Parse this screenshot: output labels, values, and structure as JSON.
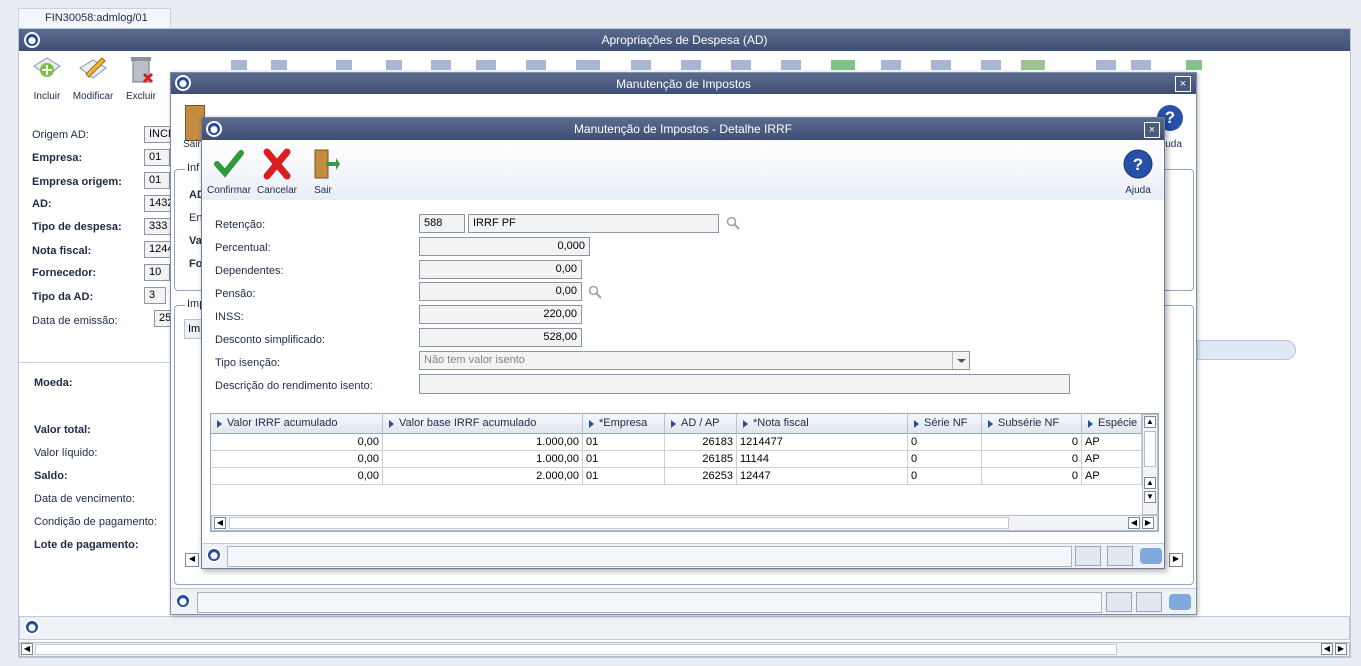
{
  "tab": {
    "label": "FIN30058:admlog/01"
  },
  "main": {
    "title": "Apropriações de Despesa (AD)",
    "toolbar": {
      "incluir": "Incluir",
      "modificar": "Modificar",
      "excluir": "Excluir"
    },
    "fields": [
      {
        "label": "Origem AD:",
        "value": "INCL",
        "bold": false
      },
      {
        "label": "Empresa:",
        "value": "01",
        "bold": true
      },
      {
        "label": "Empresa origem:",
        "value": "01",
        "bold": true
      },
      {
        "label": "AD:",
        "value": "1432",
        "bold": true
      },
      {
        "label": "Tipo de despesa:",
        "value": "333",
        "bold": true
      },
      {
        "label": "Nota fiscal:",
        "value": "1244",
        "bold": true
      },
      {
        "label": "Fornecedor:",
        "value": "10",
        "bold": true
      },
      {
        "label": "Tipo da AD:",
        "value": "3",
        "bold": true
      },
      {
        "label": "Data de emissão:",
        "value": "25",
        "bold": false
      }
    ],
    "lower": {
      "moeda": "Moeda:",
      "valor_total": "Valor total:",
      "valor_liquido": "Valor líquido:",
      "saldo": "Saldo:",
      "data_vencimento": "Data de vencimento:",
      "condicao_pagamento": "Condição de pagamento:",
      "lote_pagamento": "Lote de pagamento:"
    }
  },
  "mid": {
    "title": "Manutenção de Impostos",
    "sair": "Sair",
    "ajuda": "juda",
    "group_info": "Inf",
    "group_imp": "Imp",
    "row_ad": "AD",
    "row_en": "En",
    "row_va": "Va",
    "row_fo": "Fo",
    "grid_im": "Im"
  },
  "detail": {
    "title": "Manutenção de Impostos - Detalhe IRRF",
    "toolbar": {
      "confirmar": "Confirmar",
      "cancelar": "Cancelar",
      "sair": "Sair",
      "ajuda": "Ajuda"
    },
    "retencao": {
      "label": "Retenção:",
      "code": "588",
      "desc": "IRRF PF"
    },
    "percentual": {
      "label": "Percentual:",
      "value": "0,000"
    },
    "dependentes": {
      "label": "Dependentes:",
      "value": "0,00"
    },
    "pensao": {
      "label": "Pensão:",
      "value": "0,00"
    },
    "inss": {
      "label": "INSS:",
      "value": "220,00"
    },
    "desconto": {
      "label": "Desconto simplificado:",
      "value": "528,00"
    },
    "tipo_isencao": {
      "label": "Tipo isenção:",
      "value": "Não tem valor isento"
    },
    "descricao": {
      "label": "Descrição do rendimento isento:",
      "value": ""
    },
    "grid": {
      "headers": [
        "Valor IRRF acumulado",
        "Valor base IRRF acumulado",
        "*Empresa",
        "AD / AP",
        "*Nota fiscal",
        "Série NF",
        "Subsérie NF",
        "Espécie"
      ],
      "rows": [
        [
          "0,00",
          "1.000,00",
          "01",
          "26183",
          "1214477",
          "0",
          "0",
          "AP"
        ],
        [
          "0,00",
          "1.000,00",
          "01",
          "26185",
          "11144",
          "0",
          "0",
          "AP"
        ],
        [
          "0,00",
          "2.000,00",
          "01",
          "26253",
          "12447",
          "0",
          "0",
          "AP"
        ]
      ]
    }
  }
}
